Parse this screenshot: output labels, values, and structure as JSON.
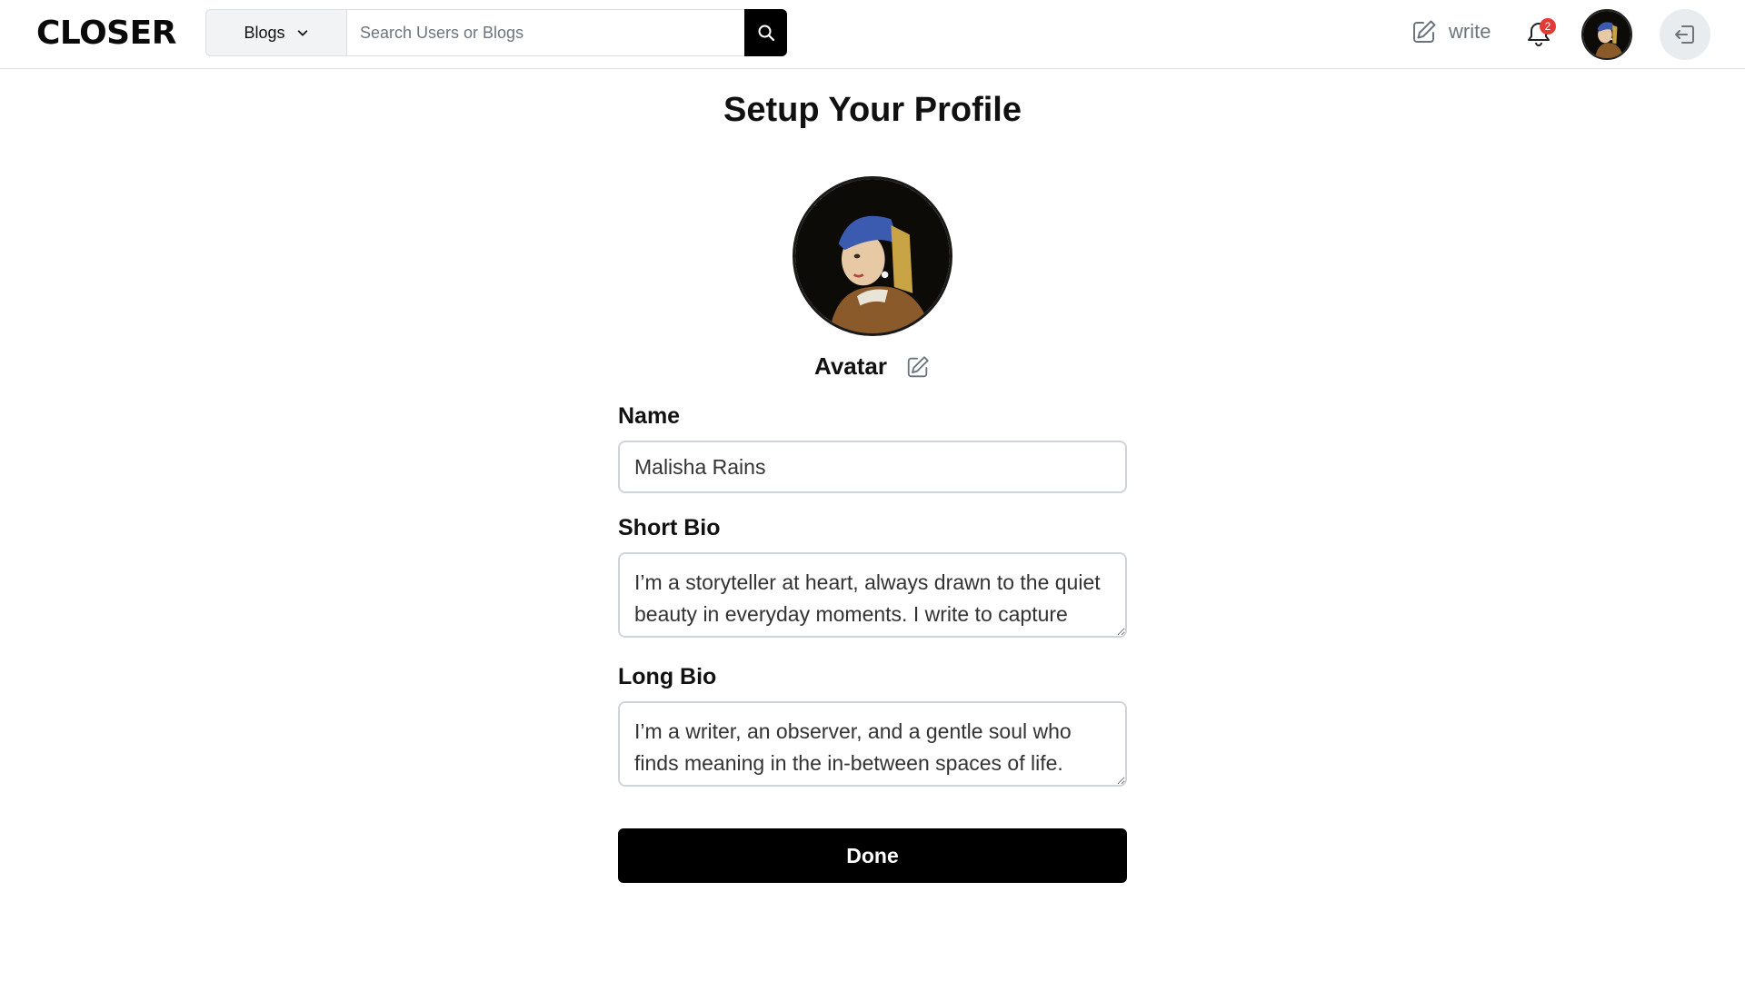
{
  "app": {
    "logo": "CLOSER"
  },
  "header": {
    "search": {
      "category_selected": "Blogs",
      "placeholder": "Search Users or Blogs",
      "value": ""
    },
    "write_label": "write",
    "notifications_count": "2",
    "icons": {
      "dropdown": "chevron-down-icon",
      "search": "search-icon",
      "write": "pencil-square-icon",
      "notifications": "bell-icon",
      "logout": "logout-icon"
    }
  },
  "page": {
    "title": "Setup Your Profile",
    "avatar_label": "Avatar",
    "fields": {
      "name": {
        "label": "Name",
        "value": "Malisha Rains"
      },
      "short_bio": {
        "label": "Short Bio",
        "value": "I’m a storyteller at heart, always drawn to the quiet beauty in everyday moments. I write to capture fleeting thoughts, fading light, and the little things that make life feel whole."
      },
      "long_bio": {
        "label": "Long Bio",
        "value": "I’m a writer, an observer, and a gentle soul who finds meaning in the in-between spaces of life. Through my words, I try to hold on to moments that slip by too quickly."
      }
    },
    "done_label": "Done"
  },
  "colors": {
    "primary": "#000000",
    "border": "#ced4da",
    "muted": "#6c757d",
    "badge": "#e53935"
  }
}
